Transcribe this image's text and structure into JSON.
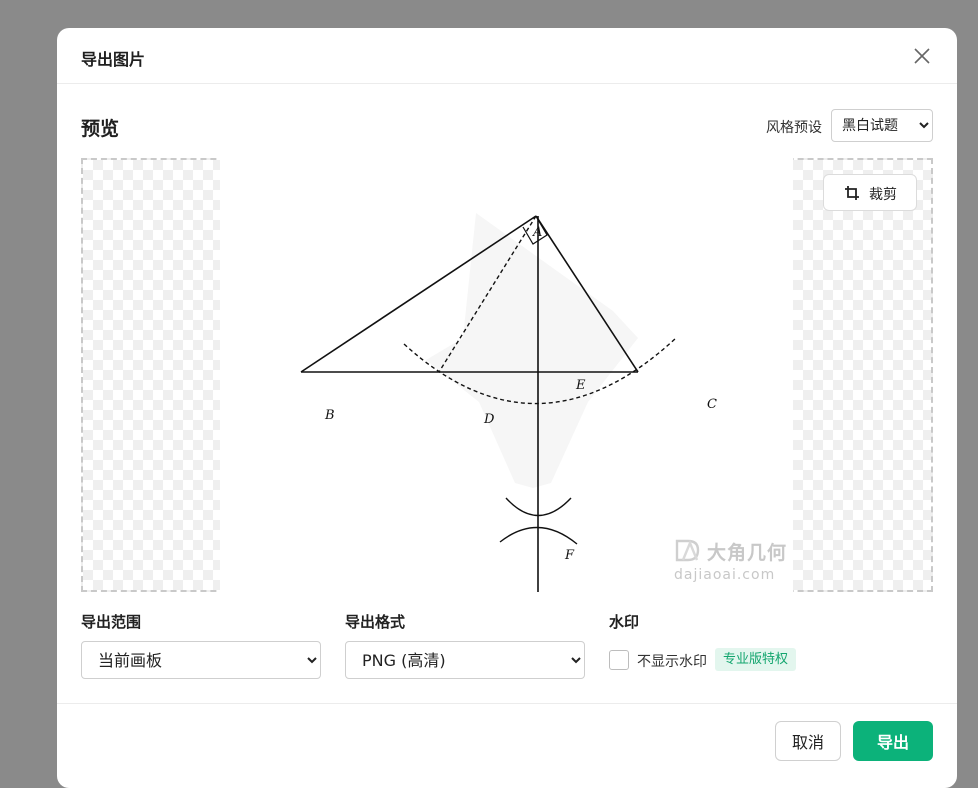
{
  "dialog": {
    "title": "导出图片"
  },
  "preview": {
    "title": "预览",
    "style_label": "风格预设",
    "style_selected": "黑白试题",
    "crop_label": "裁剪"
  },
  "diagram": {
    "points": [
      "A",
      "B",
      "C",
      "D",
      "E",
      "F"
    ]
  },
  "watermark_preview": {
    "brand": "大角几何",
    "url": "dajiaoai.com"
  },
  "export_range": {
    "label": "导出范围",
    "selected": "当前画板"
  },
  "export_format": {
    "label": "导出格式",
    "selected": "PNG (高清)"
  },
  "watermark": {
    "label": "水印",
    "checkbox_label": "不显示水印",
    "badge": "专业版特权",
    "checked": false
  },
  "footer": {
    "cancel": "取消",
    "export": "导出"
  },
  "colors": {
    "primary": "#0cb27a",
    "badge_bg": "#e3f6ee",
    "badge_text": "#13a56e"
  }
}
